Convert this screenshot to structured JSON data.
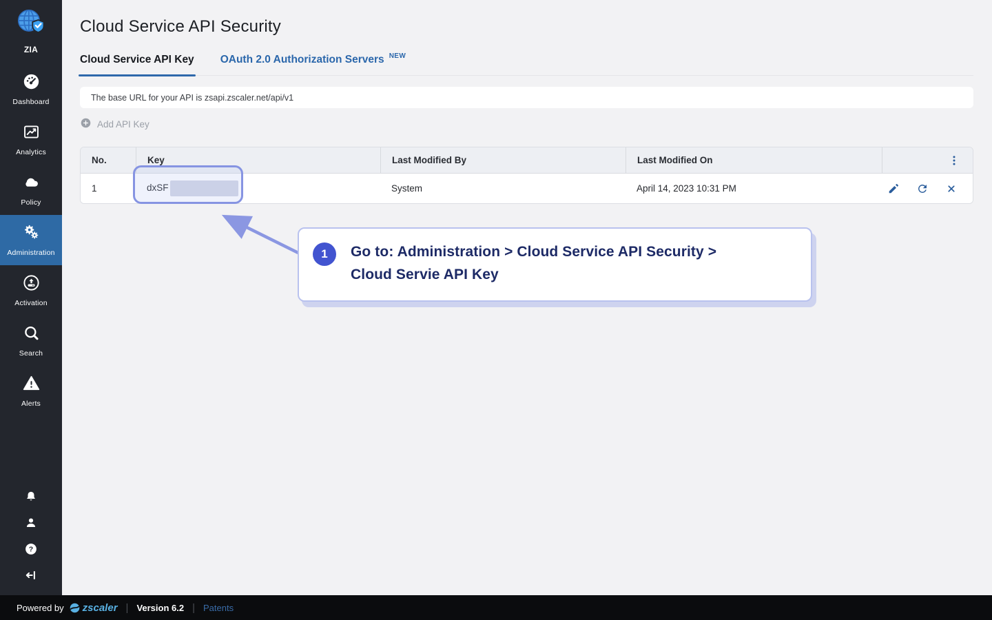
{
  "sidebar": {
    "logo": {
      "label": "ZIA",
      "icon": "zia-globe-shield-icon"
    },
    "items": [
      {
        "label": "Dashboard",
        "icon": "gauge-icon",
        "active": false
      },
      {
        "label": "Analytics",
        "icon": "line-chart-icon",
        "active": false
      },
      {
        "label": "Policy",
        "icon": "cloud-icon",
        "active": false
      },
      {
        "label": "Administration",
        "icon": "gears-icon",
        "active": true
      },
      {
        "label": "Activation",
        "icon": "activation-upload-icon",
        "active": false
      },
      {
        "label": "Search",
        "icon": "search-icon",
        "active": false
      },
      {
        "label": "Alerts",
        "icon": "alert-triangle-icon",
        "active": false
      }
    ],
    "bottom_icons": [
      "bell-icon",
      "user-icon",
      "help-icon",
      "collapse-sidebar-icon"
    ]
  },
  "page": {
    "title": "Cloud Service API Security"
  },
  "tabs": [
    {
      "label": "Cloud Service API Key",
      "active": true
    },
    {
      "label": "OAuth 2.0 Authorization Servers",
      "badge": "NEW",
      "active": false
    }
  ],
  "info_bar": {
    "text": "The base URL for your API is zsapi.zscaler.net/api/v1"
  },
  "toolbar": {
    "add_api_key_label": "Add API Key",
    "icon": "plus-circle-icon"
  },
  "table": {
    "columns": [
      "No.",
      "Key",
      "Last Modified By",
      "Last Modified On"
    ],
    "header_menu_icon": "kebab-menu-icon",
    "rows": [
      {
        "no": "1",
        "key_visible": "dxSF",
        "key_redacted": true,
        "last_modified_by": "System",
        "last_modified_on": "April 14, 2023 10:31 PM"
      }
    ],
    "row_actions": [
      "edit-icon",
      "refresh-icon",
      "delete-icon"
    ]
  },
  "annotation": {
    "step_number": "1",
    "text_line1": "Go to: Administration > Cloud Service API Security >",
    "text_line2": "Cloud Servie API Key"
  },
  "footer": {
    "powered_by": "Powered by",
    "brand": "zscaler",
    "separator": "|",
    "version": "Version 6.2",
    "patents_link": "Patents"
  },
  "colors": {
    "sidebar_bg": "#23262d",
    "sidebar_active_bg": "#2e6aa5",
    "accent_blue": "#2b67ab",
    "action_icon_blue": "#2a5d9c",
    "annotation_purple": "#8b97e2",
    "callout_text_navy": "#1d2a66",
    "step_circle_blue": "#4254d0",
    "footer_bg": "#0b0c0e",
    "brand_blue": "#59b1e3",
    "redaction_gray": "#d3d6e5"
  }
}
